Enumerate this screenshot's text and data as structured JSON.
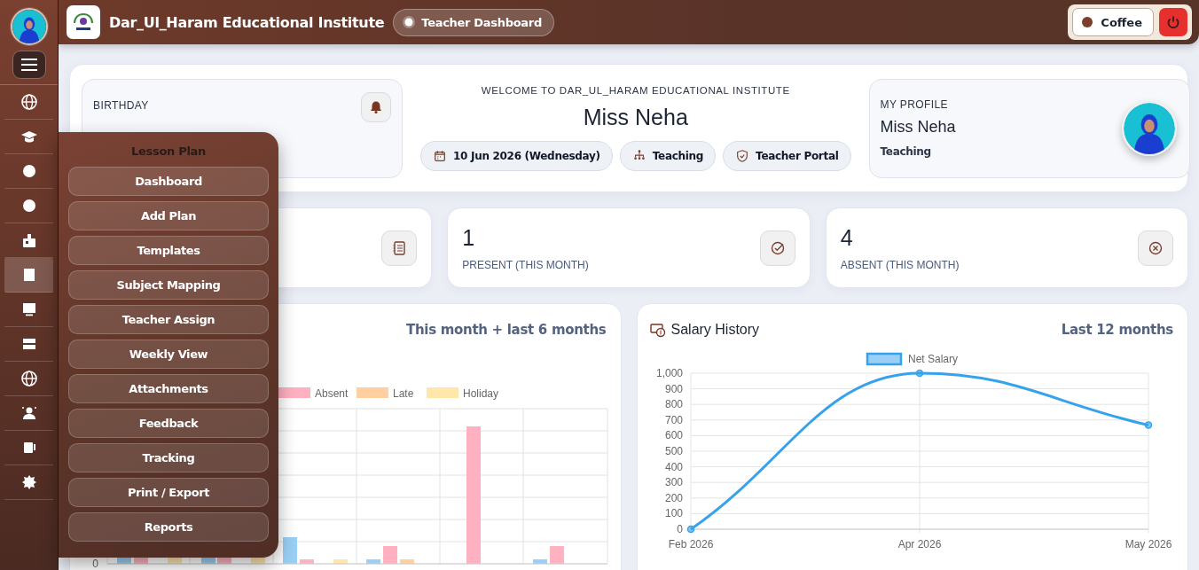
{
  "sidebar": {
    "items": [
      {
        "selected": false
      },
      {
        "selected": false
      },
      {
        "selected": false
      },
      {
        "selected": false
      },
      {
        "selected": false
      },
      {
        "selected": true
      },
      {
        "selected": false
      },
      {
        "selected": false
      },
      {
        "selected": false
      },
      {
        "selected": false
      },
      {
        "selected": false
      },
      {
        "selected": false
      }
    ]
  },
  "header": {
    "title": "Dar_Ul_Haram Educational Institute",
    "badge": "Teacher Dashboard",
    "theme_button": "Coffee"
  },
  "welcome": {
    "birthday": {
      "label": "BIRTHDAY"
    },
    "heading": "WELCOME TO DAR_UL_HARAM EDUCATIONAL INSTITUTE",
    "name": "Miss Neha",
    "chips": [
      "10 Jun 2026 (Wednesday)",
      "Teaching",
      "Teacher Portal"
    ],
    "profile": {
      "label": "MY PROFILE",
      "name": "Miss Neha",
      "role": "Teaching"
    }
  },
  "stats": [
    {
      "value": "1",
      "label": "PRESENT (THIS MONTH)"
    },
    {
      "value": "4",
      "label": "ABSENT (THIS MONTH)"
    }
  ],
  "attendance_chart": {
    "range": "This month + last 6 months",
    "legend": [
      {
        "label": "Absent",
        "color": "#ffb1c1"
      },
      {
        "label": "Late",
        "color": "#ffcf9f"
      },
      {
        "label": "Holiday",
        "color": "#ffe6aa"
      }
    ],
    "y_tick": "0"
  },
  "salary_chart": {
    "title": "Salary History",
    "range": "Last 12 months",
    "chart_data": {
      "type": "line",
      "categories": [
        "Feb 2026",
        "Apr 2026",
        "May 2026"
      ],
      "series": [
        {
          "name": "Net Salary",
          "color": "#36a2eb",
          "marker": true,
          "values": [
            0,
            1000,
            667
          ]
        }
      ],
      "grid": true,
      "ylim": [
        0,
        1000
      ],
      "yticks": [
        0,
        100,
        200,
        300,
        400,
        500,
        600,
        700,
        800,
        900,
        {
          "value": 1000,
          "label": "1,000"
        }
      ]
    }
  },
  "lesson_menu": {
    "title": "Lesson Plan",
    "items": [
      "Dashboard",
      "Add Plan",
      "Templates",
      "Subject Mapping",
      "Teacher Assign",
      "Weekly View",
      "Attachments",
      "Feedback",
      "Tracking",
      "Print / Export",
      "Reports"
    ]
  }
}
